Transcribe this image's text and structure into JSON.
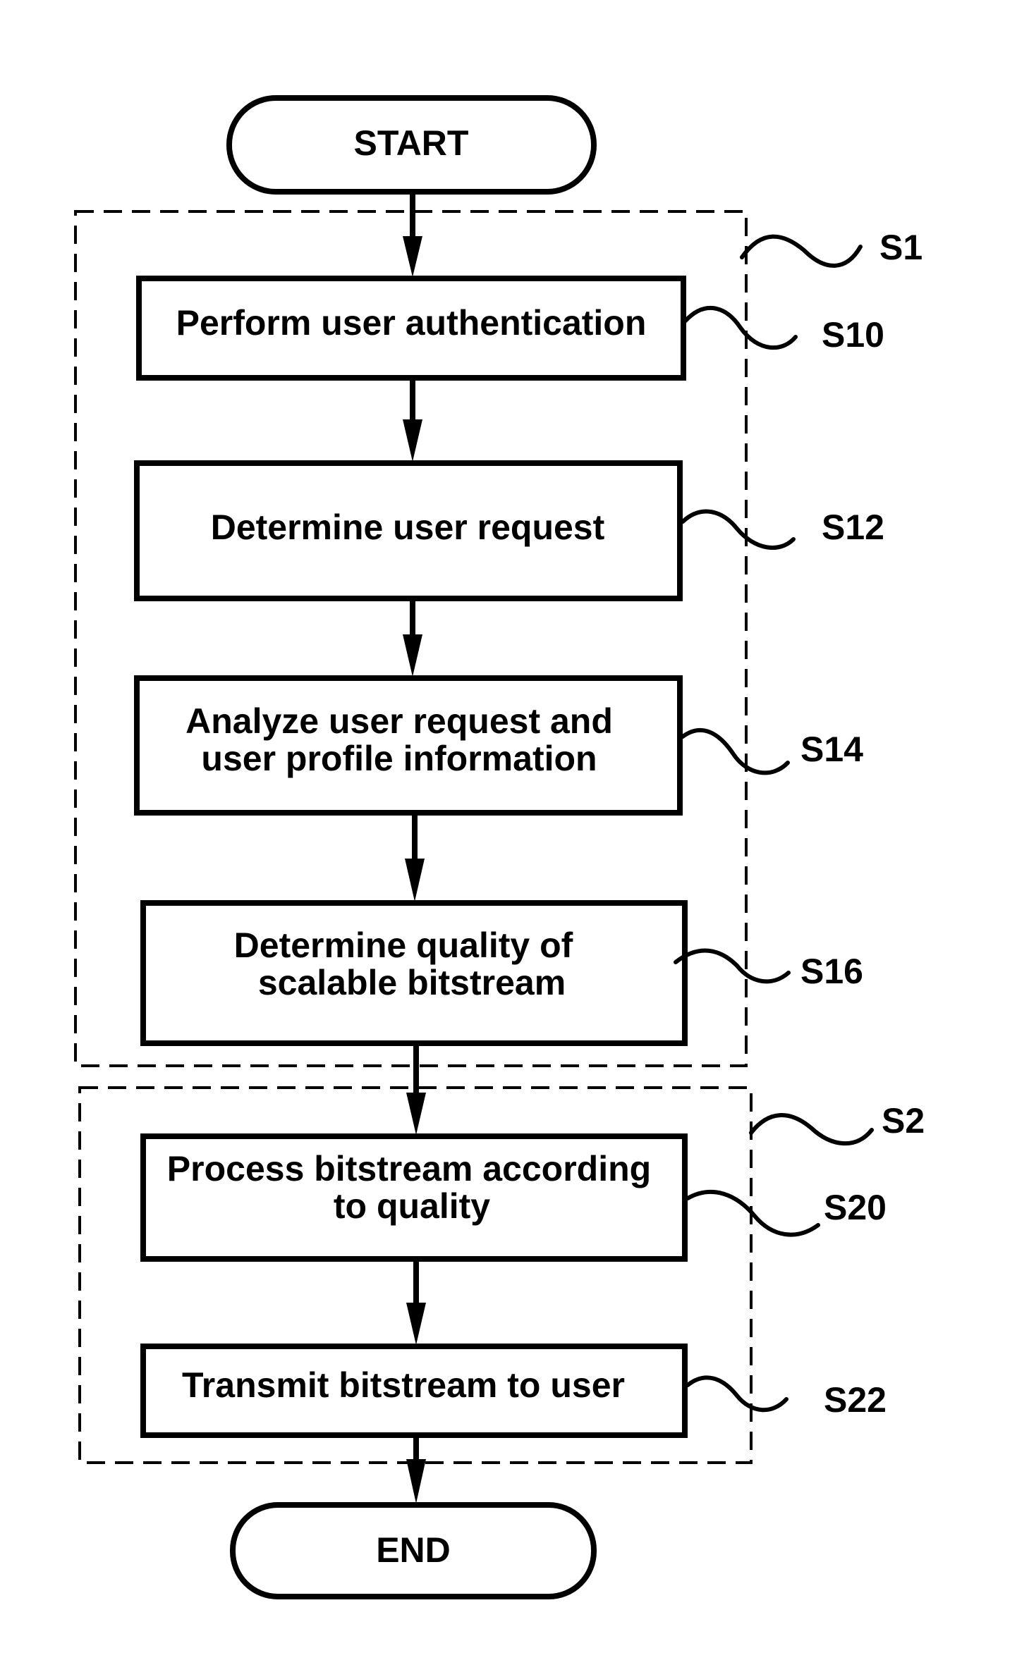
{
  "diagram": {
    "type": "flowchart",
    "start_label": "START",
    "end_label": "END",
    "groups": [
      {
        "id": "S1",
        "label": "S1"
      },
      {
        "id": "S2",
        "label": "S2"
      }
    ],
    "steps": [
      {
        "id": "S10",
        "ref": "S10",
        "lines": [
          "Perform user authentication"
        ]
      },
      {
        "id": "S12",
        "ref": "S12",
        "lines": [
          "Determine user request"
        ]
      },
      {
        "id": "S14",
        "ref": "S14",
        "lines": [
          "Analyze user request and",
          "user profile information"
        ]
      },
      {
        "id": "S16",
        "ref": "S16",
        "lines": [
          "Determine quality of",
          "scalable bitstream"
        ]
      },
      {
        "id": "S20",
        "ref": "S20",
        "lines": [
          "Process bitstream according",
          "to quality"
        ]
      },
      {
        "id": "S22",
        "ref": "S22",
        "lines": [
          "Transmit bitstream to user"
        ]
      }
    ],
    "edges": [
      [
        "START",
        "S10"
      ],
      [
        "S10",
        "S12"
      ],
      [
        "S12",
        "S14"
      ],
      [
        "S14",
        "S16"
      ],
      [
        "S16",
        "S20"
      ],
      [
        "S20",
        "S22"
      ],
      [
        "S22",
        "END"
      ]
    ]
  }
}
